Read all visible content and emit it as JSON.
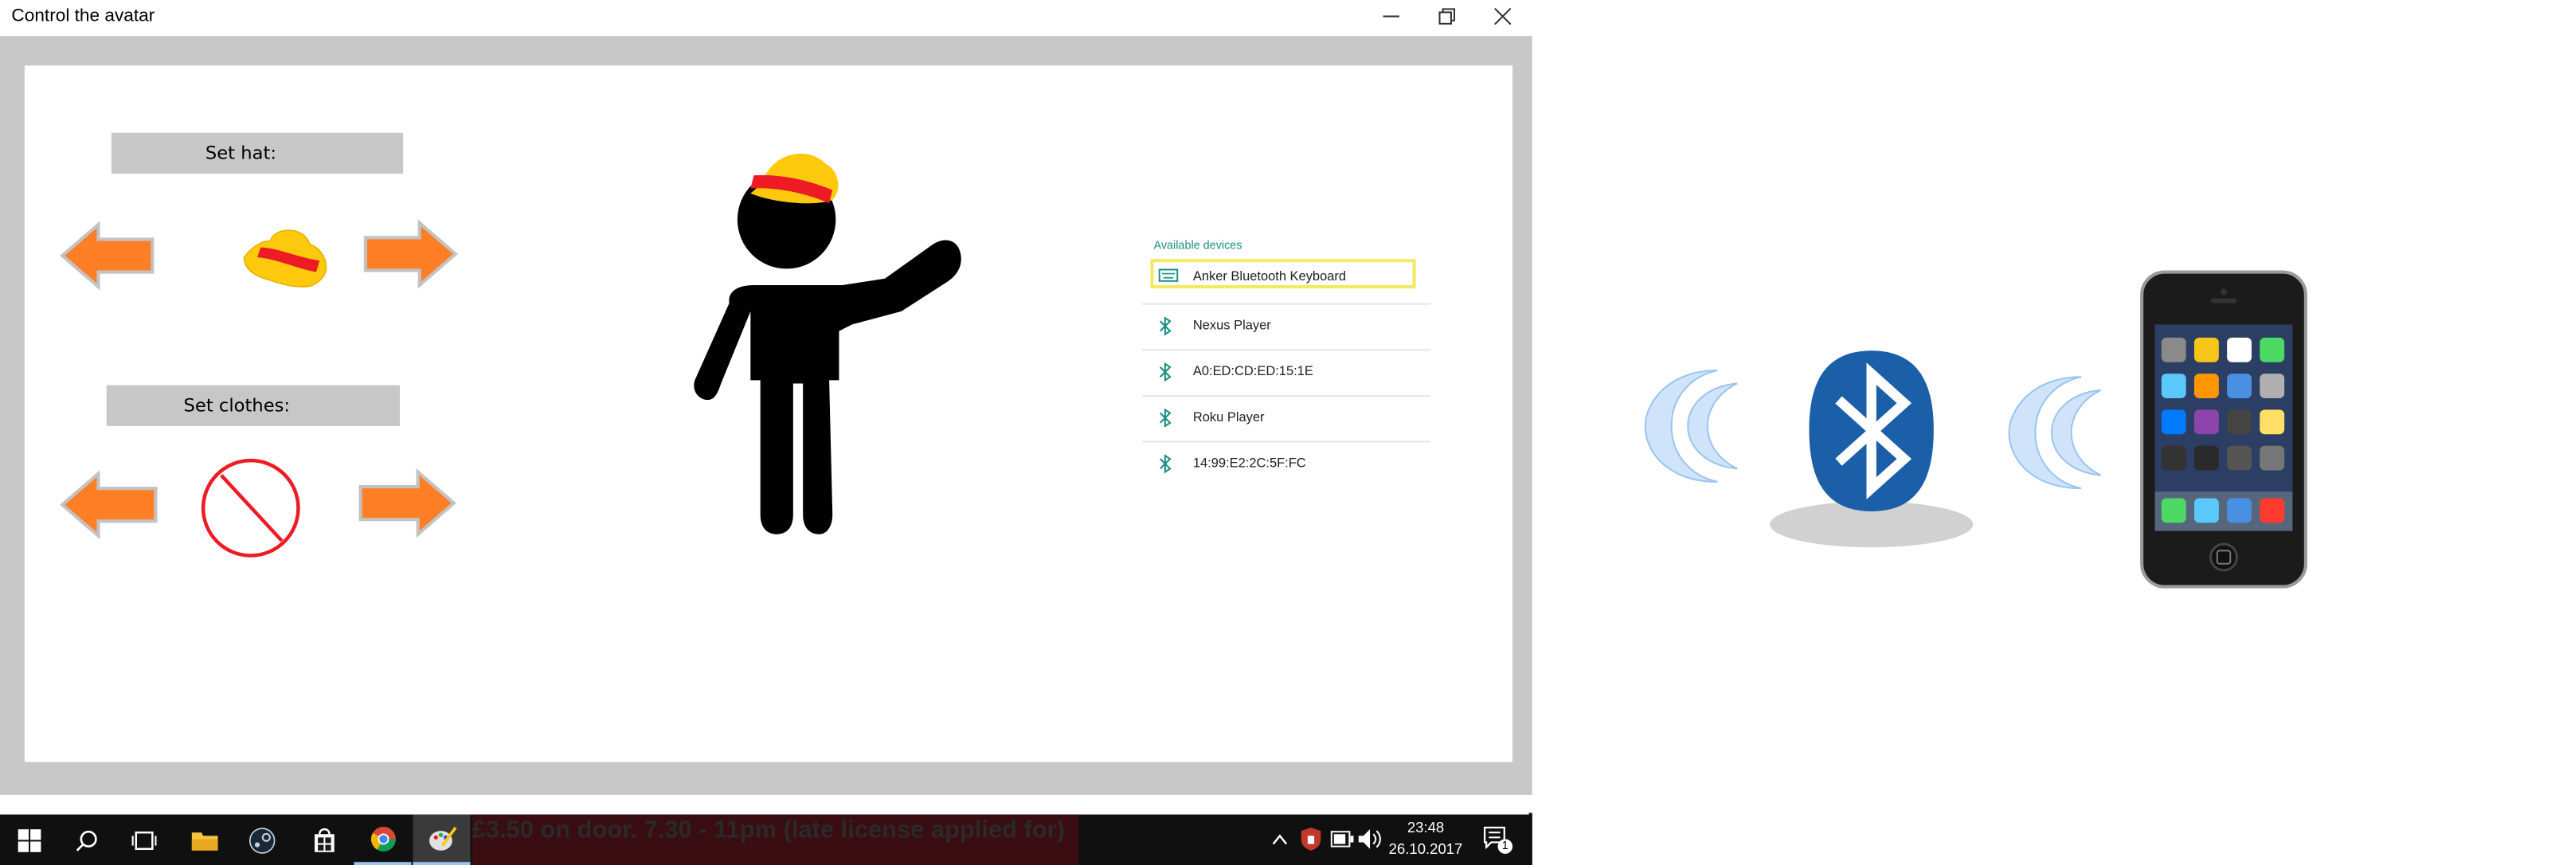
{
  "window": {
    "title": "Control the avatar",
    "minimize_glyph": "–",
    "restore_glyph": "❐",
    "close_glyph": "✕"
  },
  "controls": {
    "hat_label": "Set hat:",
    "clothes_label": "Set clothes:",
    "current_hat_icon": "straw-hat-icon",
    "current_clothes_icon": "none-prohibited-icon"
  },
  "devices": {
    "heading": "Available devices",
    "items": [
      {
        "name": "Anker Bluetooth Keyboard",
        "icon": "keyboard-icon",
        "selected": true
      },
      {
        "name": "Nexus Player",
        "icon": "bluetooth-icon",
        "selected": false
      },
      {
        "name": "A0:ED:CD:ED:15:1E",
        "icon": "bluetooth-icon",
        "selected": false
      },
      {
        "name": "Roku Player",
        "icon": "bluetooth-icon",
        "selected": false
      },
      {
        "name": "14:99:E2:2C:5F:FC",
        "icon": "bluetooth-icon",
        "selected": false
      }
    ]
  },
  "taskbar": {
    "marquee_text": "£3.50 on door. 7.30 - 11pm (late license applied for)",
    "time": "23:48",
    "date": "26.10.2017",
    "notification_count": "1",
    "icons": [
      "windows-start-icon",
      "search-icon",
      "task-view-icon",
      "file-explorer-icon",
      "steam-icon",
      "store-icon",
      "chrome-icon",
      "paint-icon"
    ]
  },
  "colors": {
    "arrow": "#ff7f27",
    "hat_yellow": "#ffc90e",
    "hat_band": "#ed1c24",
    "bluetooth_blue": "#1a5fa8",
    "accent_teal": "#1a8f82"
  }
}
